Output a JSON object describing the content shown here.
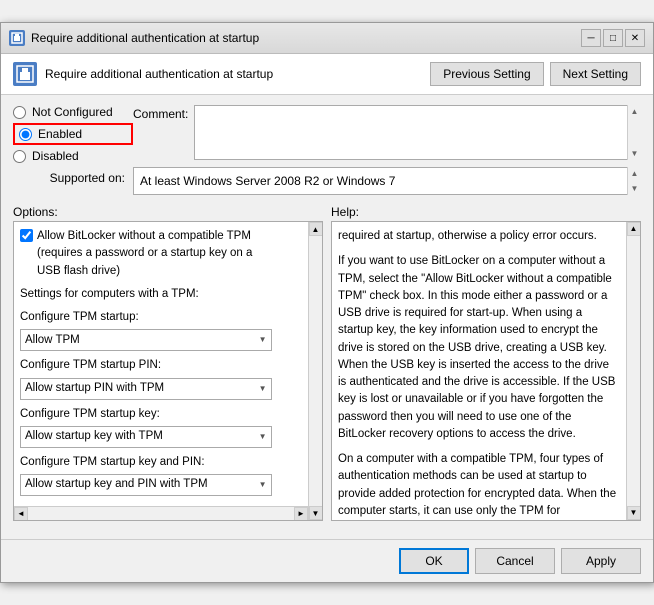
{
  "titleBar": {
    "title": "Require additional authentication at startup",
    "minBtn": "─",
    "maxBtn": "□",
    "closeBtn": "✕"
  },
  "header": {
    "title": "Require additional authentication at startup",
    "prevBtn": "Previous Setting",
    "nextBtn": "Next Setting"
  },
  "radioOptions": {
    "notConfigured": "Not Configured",
    "enabled": "Enabled",
    "disabled": "Disabled"
  },
  "comment": {
    "label": "Comment:",
    "value": ""
  },
  "supported": {
    "label": "Supported on:",
    "value": "At least Windows Server 2008 R2 or Windows 7"
  },
  "options": {
    "label": "Options:",
    "checkboxLabel": "Allow BitLocker without a compatible TPM\n(requires a password or a startup key on a\nUSB flash drive)",
    "checkboxChecked": true,
    "sections": [
      {
        "label": "Settings for computers with a TPM:"
      },
      {
        "label": "Configure TPM startup:",
        "dropdown": "Allow TPM"
      },
      {
        "label": "Configure TPM startup PIN:",
        "dropdown": "Allow startup PIN with TPM"
      },
      {
        "label": "Configure TPM startup key:",
        "dropdown": "Allow startup key with TPM"
      },
      {
        "label": "Configure TPM startup key and PIN:",
        "dropdown": "Allow startup key and PIN with TPM"
      }
    ]
  },
  "help": {
    "label": "Help:",
    "paragraphs": [
      "required at startup, otherwise a policy error occurs.",
      "If you want to use BitLocker on a computer without a TPM, select the \"Allow BitLocker without a compatible TPM\" check box. In this mode either a password or a USB drive is required for start-up. When using a startup key, the key information used to encrypt the drive is stored on the USB drive, creating a USB key. When the USB key is inserted the access to the drive is authenticated and the drive is accessible. If the USB key is lost or unavailable or if you have forgotten the password then you will need to use one of the BitLocker recovery options to access the drive.",
      "On a computer with a compatible TPM, four types of authentication methods can be used at startup to provide added protection for encrypted data. When the computer starts, it can use only the TPM for authentication, or it can also require insertion of a USB flash drive containing a startup key, the entry of a 6-digit to 20-digit personal identification number (PIN), or both."
    ]
  },
  "footer": {
    "ok": "OK",
    "cancel": "Cancel",
    "apply": "Apply"
  }
}
